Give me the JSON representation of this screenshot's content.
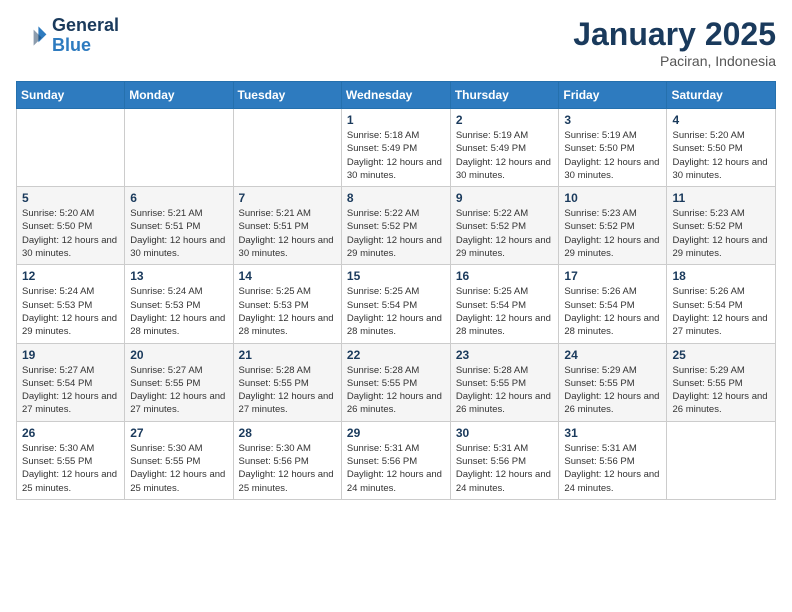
{
  "header": {
    "logo_line1": "General",
    "logo_line2": "Blue",
    "month": "January 2025",
    "location": "Paciran, Indonesia"
  },
  "weekdays": [
    "Sunday",
    "Monday",
    "Tuesday",
    "Wednesday",
    "Thursday",
    "Friday",
    "Saturday"
  ],
  "weeks": [
    [
      {
        "day": "",
        "info": ""
      },
      {
        "day": "",
        "info": ""
      },
      {
        "day": "",
        "info": ""
      },
      {
        "day": "1",
        "info": "Sunrise: 5:18 AM\nSunset: 5:49 PM\nDaylight: 12 hours and 30 minutes."
      },
      {
        "day": "2",
        "info": "Sunrise: 5:19 AM\nSunset: 5:49 PM\nDaylight: 12 hours and 30 minutes."
      },
      {
        "day": "3",
        "info": "Sunrise: 5:19 AM\nSunset: 5:50 PM\nDaylight: 12 hours and 30 minutes."
      },
      {
        "day": "4",
        "info": "Sunrise: 5:20 AM\nSunset: 5:50 PM\nDaylight: 12 hours and 30 minutes."
      }
    ],
    [
      {
        "day": "5",
        "info": "Sunrise: 5:20 AM\nSunset: 5:50 PM\nDaylight: 12 hours and 30 minutes."
      },
      {
        "day": "6",
        "info": "Sunrise: 5:21 AM\nSunset: 5:51 PM\nDaylight: 12 hours and 30 minutes."
      },
      {
        "day": "7",
        "info": "Sunrise: 5:21 AM\nSunset: 5:51 PM\nDaylight: 12 hours and 30 minutes."
      },
      {
        "day": "8",
        "info": "Sunrise: 5:22 AM\nSunset: 5:52 PM\nDaylight: 12 hours and 29 minutes."
      },
      {
        "day": "9",
        "info": "Sunrise: 5:22 AM\nSunset: 5:52 PM\nDaylight: 12 hours and 29 minutes."
      },
      {
        "day": "10",
        "info": "Sunrise: 5:23 AM\nSunset: 5:52 PM\nDaylight: 12 hours and 29 minutes."
      },
      {
        "day": "11",
        "info": "Sunrise: 5:23 AM\nSunset: 5:52 PM\nDaylight: 12 hours and 29 minutes."
      }
    ],
    [
      {
        "day": "12",
        "info": "Sunrise: 5:24 AM\nSunset: 5:53 PM\nDaylight: 12 hours and 29 minutes."
      },
      {
        "day": "13",
        "info": "Sunrise: 5:24 AM\nSunset: 5:53 PM\nDaylight: 12 hours and 28 minutes."
      },
      {
        "day": "14",
        "info": "Sunrise: 5:25 AM\nSunset: 5:53 PM\nDaylight: 12 hours and 28 minutes."
      },
      {
        "day": "15",
        "info": "Sunrise: 5:25 AM\nSunset: 5:54 PM\nDaylight: 12 hours and 28 minutes."
      },
      {
        "day": "16",
        "info": "Sunrise: 5:25 AM\nSunset: 5:54 PM\nDaylight: 12 hours and 28 minutes."
      },
      {
        "day": "17",
        "info": "Sunrise: 5:26 AM\nSunset: 5:54 PM\nDaylight: 12 hours and 28 minutes."
      },
      {
        "day": "18",
        "info": "Sunrise: 5:26 AM\nSunset: 5:54 PM\nDaylight: 12 hours and 27 minutes."
      }
    ],
    [
      {
        "day": "19",
        "info": "Sunrise: 5:27 AM\nSunset: 5:54 PM\nDaylight: 12 hours and 27 minutes."
      },
      {
        "day": "20",
        "info": "Sunrise: 5:27 AM\nSunset: 5:55 PM\nDaylight: 12 hours and 27 minutes."
      },
      {
        "day": "21",
        "info": "Sunrise: 5:28 AM\nSunset: 5:55 PM\nDaylight: 12 hours and 27 minutes."
      },
      {
        "day": "22",
        "info": "Sunrise: 5:28 AM\nSunset: 5:55 PM\nDaylight: 12 hours and 26 minutes."
      },
      {
        "day": "23",
        "info": "Sunrise: 5:28 AM\nSunset: 5:55 PM\nDaylight: 12 hours and 26 minutes."
      },
      {
        "day": "24",
        "info": "Sunrise: 5:29 AM\nSunset: 5:55 PM\nDaylight: 12 hours and 26 minutes."
      },
      {
        "day": "25",
        "info": "Sunrise: 5:29 AM\nSunset: 5:55 PM\nDaylight: 12 hours and 26 minutes."
      }
    ],
    [
      {
        "day": "26",
        "info": "Sunrise: 5:30 AM\nSunset: 5:55 PM\nDaylight: 12 hours and 25 minutes."
      },
      {
        "day": "27",
        "info": "Sunrise: 5:30 AM\nSunset: 5:55 PM\nDaylight: 12 hours and 25 minutes."
      },
      {
        "day": "28",
        "info": "Sunrise: 5:30 AM\nSunset: 5:56 PM\nDaylight: 12 hours and 25 minutes."
      },
      {
        "day": "29",
        "info": "Sunrise: 5:31 AM\nSunset: 5:56 PM\nDaylight: 12 hours and 24 minutes."
      },
      {
        "day": "30",
        "info": "Sunrise: 5:31 AM\nSunset: 5:56 PM\nDaylight: 12 hours and 24 minutes."
      },
      {
        "day": "31",
        "info": "Sunrise: 5:31 AM\nSunset: 5:56 PM\nDaylight: 12 hours and 24 minutes."
      },
      {
        "day": "",
        "info": ""
      }
    ]
  ]
}
